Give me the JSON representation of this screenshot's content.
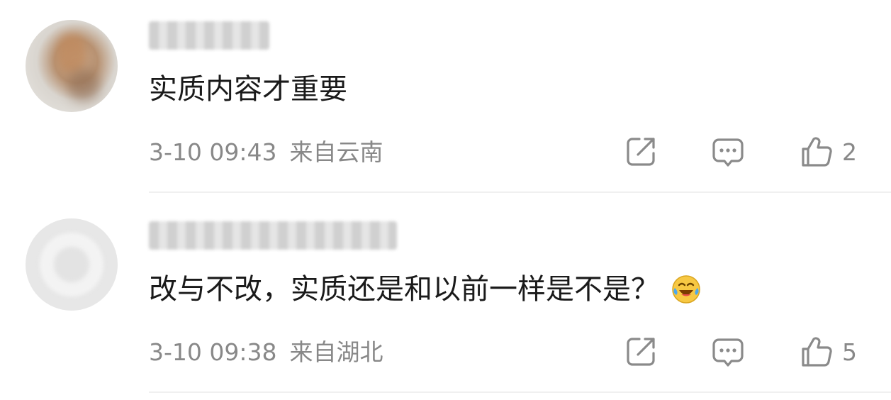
{
  "comments": [
    {
      "content": "实质内容才重要",
      "time": "3-10 09:43",
      "location": "来自云南",
      "likes": "2",
      "icons": {
        "share": "share-icon",
        "reply": "comment-icon",
        "like": "thumbs-up-icon"
      }
    },
    {
      "content": "改与不改，实质还是和以前一样是不是？",
      "emoji": "laughing-tears-emoji",
      "time": "3-10 09:38",
      "location": "来自湖北",
      "likes": "5",
      "icons": {
        "share": "share-icon",
        "reply": "comment-icon",
        "like": "thumbs-up-icon"
      }
    }
  ],
  "colors": {
    "text": "#1a1a1a",
    "meta": "#888888",
    "icon": "#8a8a8a",
    "divider": "#f0f0f0"
  }
}
